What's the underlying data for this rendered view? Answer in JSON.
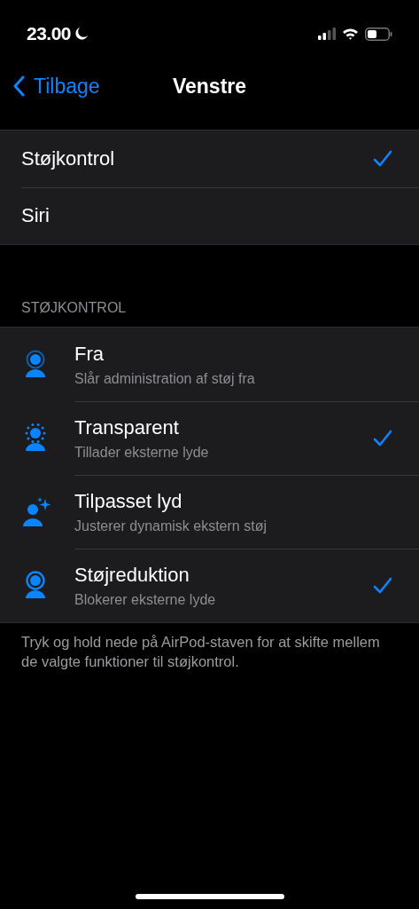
{
  "status_bar": {
    "time": "23.00"
  },
  "nav": {
    "back": "Tilbage",
    "title": "Venstre"
  },
  "options": [
    {
      "label": "Støjkontrol",
      "selected": true
    },
    {
      "label": "Siri",
      "selected": false
    }
  ],
  "section_header": "STØJKONTROL",
  "modes": [
    {
      "kind": "off",
      "title": "Fra",
      "subtitle": "Slår administration af støj fra",
      "checked": false
    },
    {
      "kind": "transparency",
      "title": "Transparent",
      "subtitle": "Tillader eksterne lyde",
      "checked": true
    },
    {
      "kind": "adaptive",
      "title": "Tilpasset lyd",
      "subtitle": "Justerer dynamisk ekstern støj",
      "checked": false
    },
    {
      "kind": "noise_cancel",
      "title": "Støjreduktion",
      "subtitle": "Blokerer eksterne lyde",
      "checked": true
    }
  ],
  "footer": "Tryk og hold nede på AirPod-staven for at skifte mellem de valgte funktioner til støjkontrol."
}
